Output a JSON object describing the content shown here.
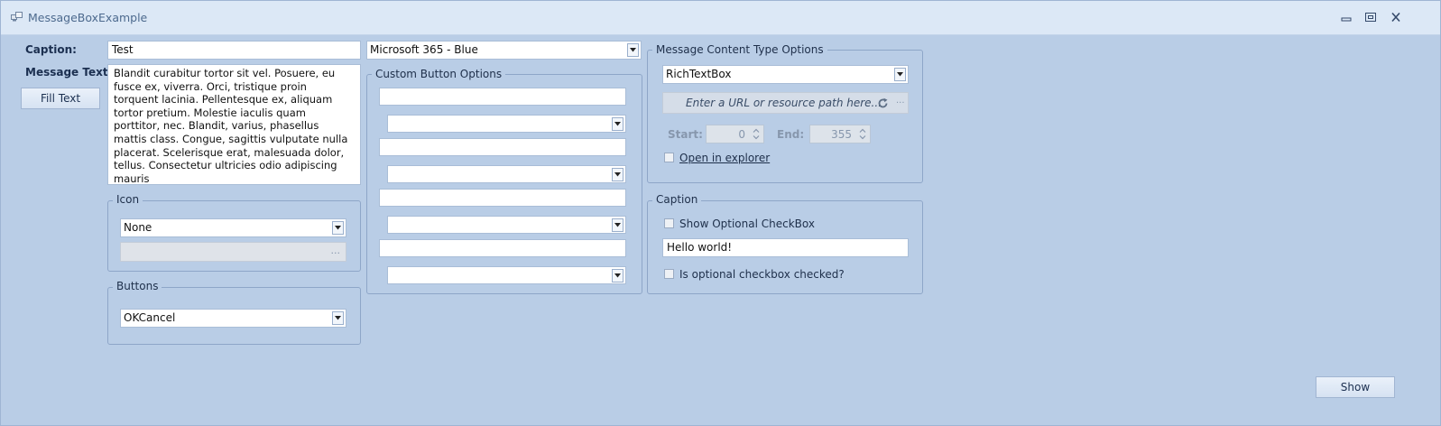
{
  "window": {
    "title": "MessageBoxExample",
    "icons": [
      "app-icon",
      "minimize-icon",
      "restore-icon",
      "close-icon"
    ]
  },
  "caption": {
    "label": "Caption:",
    "value": "Test"
  },
  "theme": {
    "selected": "Microsoft 365 - Blue"
  },
  "message": {
    "label": "Message Text:",
    "text": "Blandit curabitur tortor sit vel. Posuere, eu fusce ex, viverra. Orci, tristique proin torquent lacinia. Pellentesque ex, aliquam tortor pretium. Molestie iaculis quam porttitor, nec. Blandit, varius, phasellus mattis class. Congue, sagittis vulputate nulla placerat. Scelerisque erat, malesuada dolor, tellus. Consectetur ultricies odio adipiscing mauris",
    "fill_button": "Fill Text"
  },
  "icon_group": {
    "title": "Icon",
    "selected": "None",
    "browse_label": "..."
  },
  "buttons_group": {
    "title": "Buttons",
    "selected": "OKCancel"
  },
  "custom_buttons": {
    "title": "Custom Button Options",
    "rows": [
      {
        "text": "",
        "combo": ""
      },
      {
        "text": "",
        "combo": ""
      },
      {
        "text": "",
        "combo": ""
      },
      {
        "text": "",
        "combo": ""
      }
    ]
  },
  "content_type": {
    "title": "Message Content Type Options",
    "selected": "RichTextBox",
    "url_placeholder": "Enter a URL or resource path here...",
    "browse_label": "...",
    "start_label": "Start:",
    "start_value": "0",
    "end_label": "End:",
    "end_value": "355",
    "open_explorer": "Open in explorer"
  },
  "caption_group": {
    "title": "Caption",
    "show_checkbox": "Show Optional CheckBox",
    "checkbox_text": "Hello world!",
    "checked_label": "Is optional checkbox checked?"
  },
  "show_button": "Show"
}
